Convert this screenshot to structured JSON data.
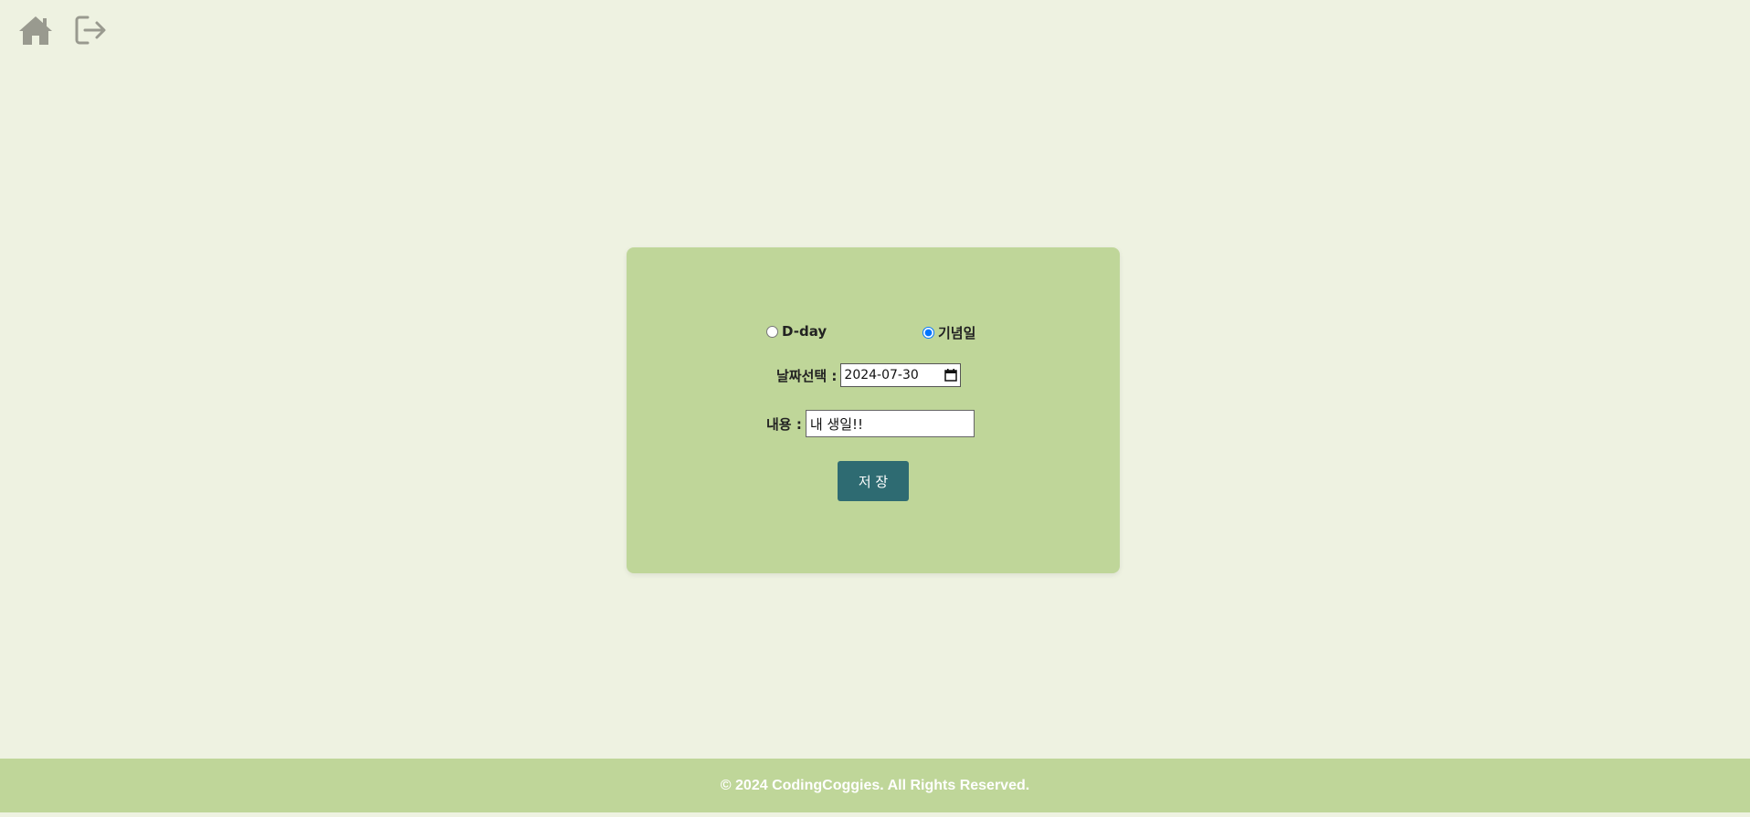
{
  "nav": {
    "home_icon": "home-icon",
    "logout_icon": "logout-icon",
    "icon_color": "#999a8f"
  },
  "form": {
    "radio_dday_label": "D-day",
    "radio_anniversary_label": "기념일",
    "selected_type": "기념일",
    "date_label": "날짜선택 :",
    "date_value": "2024-07-30",
    "content_label": "내용 :",
    "content_value": "내 생일!!",
    "save_label": "저 장"
  },
  "footer": {
    "text": "© 2024 CodingCoggies. All Rights Reserved."
  },
  "colors": {
    "background": "#eef2e1",
    "card": "#bfd699",
    "button": "#2e6b72",
    "footer": "#bfd699"
  }
}
